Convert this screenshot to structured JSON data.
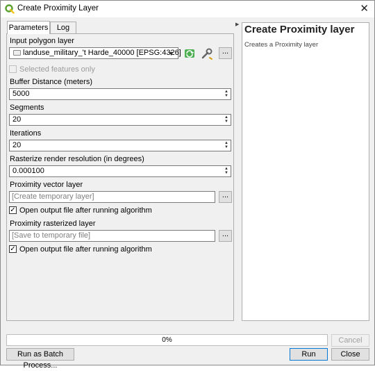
{
  "window": {
    "title": "Create Proximity Layer",
    "close_glyph": "✕"
  },
  "tabs": [
    {
      "label": "Parameters"
    },
    {
      "label": "Log"
    }
  ],
  "params": {
    "input_label": "Input polygon layer",
    "input_value": "landuse_military_'t Harde_40000 [EPSG:4326]",
    "selected_only_label": "Selected features only",
    "buffer_label": "Buffer Distance (meters)",
    "buffer_value": "5000",
    "segments_label": "Segments",
    "segments_value": "20",
    "iterations_label": "Iterations",
    "iterations_value": "20",
    "resolution_label": "Rasterize render resolution (in degrees)",
    "resolution_value": "0.000100",
    "vector_label": "Proximity vector layer",
    "vector_placeholder": "[Create temporary layer]",
    "open_vector_label": "Open output file after running algorithm",
    "raster_label": "Proximity rasterized layer",
    "raster_placeholder": "[Save to temporary file]",
    "open_raster_label": "Open output file after running algorithm",
    "dots_label": "..."
  },
  "help": {
    "title": "Create Proximity layer",
    "description": "Creates a Proximity layer"
  },
  "progress": {
    "text": "0%",
    "value": 0
  },
  "buttons": {
    "cancel": "Cancel",
    "batch": "Run as Batch Process...",
    "run": "Run",
    "close": "Close"
  },
  "colors": {
    "progress_fill": "#06b025",
    "default_button_border": "#0078d7",
    "qgis_green": "#5aa02c"
  }
}
